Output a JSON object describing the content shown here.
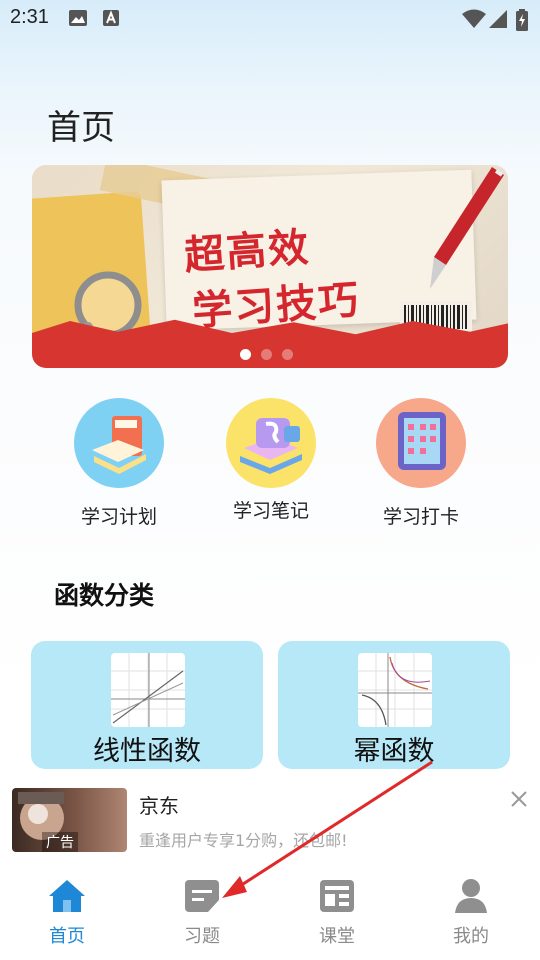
{
  "status_bar": {
    "time": "2:31",
    "icons": [
      "image-icon",
      "text-a-icon",
      "wifi-icon",
      "signal-icon",
      "battery-icon"
    ]
  },
  "page": {
    "title": "首页"
  },
  "banner": {
    "line1": "超高效",
    "line2": "学习技巧",
    "slides": 3,
    "active_slide": 1
  },
  "quick_actions": [
    {
      "label": "学习计划",
      "icon": "book-icon",
      "bg": "#7fd1f4"
    },
    {
      "label": "学习笔记",
      "icon": "notes-icon",
      "bg": "#fbe36a"
    },
    {
      "label": "学习打卡",
      "icon": "abacus-icon",
      "bg": "#f7a78a"
    }
  ],
  "section": {
    "title": "函数分类"
  },
  "categories": [
    {
      "label": "线性函数",
      "icon": "linear-graph-icon"
    },
    {
      "label": "幂函数",
      "icon": "power-graph-icon"
    }
  ],
  "ad": {
    "brand": "京东",
    "text": "重逢用户专享1分购，还包邮!",
    "tag": "广告"
  },
  "tabs": [
    {
      "label": "首页",
      "icon": "home-icon",
      "active": true
    },
    {
      "label": "习题",
      "icon": "exercise-icon",
      "active": false
    },
    {
      "label": "课堂",
      "icon": "classroom-icon",
      "active": false
    },
    {
      "label": "我的",
      "icon": "profile-icon",
      "active": false
    }
  ],
  "colors": {
    "accent": "#1e88d6",
    "card_bg": "#b7e8f7",
    "banner_red": "#d6362f",
    "arrow": "#e02a2a"
  }
}
